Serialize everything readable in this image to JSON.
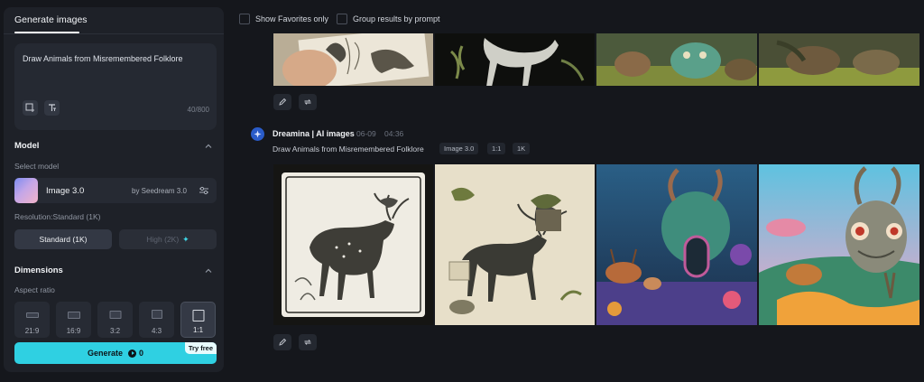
{
  "panel": {
    "tab_label": "Generate images",
    "prompt_text": "Draw Animals from Misremembered Folklore",
    "char_count": "40/800"
  },
  "model": {
    "section_title": "Model",
    "select_label": "Select model",
    "name": "Image 3.0",
    "provider": "by Seedream 3.0",
    "resolution_label": "Resolution:Standard (1K)",
    "res_standard": "Standard (1K)",
    "res_high": "High (2K)"
  },
  "dimensions": {
    "section_title": "Dimensions",
    "aspect_label": "Aspect ratio",
    "ratios": [
      "21:9",
      "16:9",
      "3:2",
      "4:3",
      "1:1"
    ],
    "selected": "1:1"
  },
  "generate": {
    "label": "Generate",
    "cost": "0",
    "badge": "Try free"
  },
  "filters": {
    "favorites_label": "Show Favorites only",
    "group_label": "Group results by prompt"
  },
  "generation": {
    "brand": "Dreamina | AI images",
    "date": "06-09",
    "time": "04:36",
    "prompt": "Draw Animals from Misremembered Folklore",
    "tags": [
      "Image 3.0",
      "1:1",
      "1K"
    ]
  },
  "colors": {
    "accent": "#2fd0e2",
    "background": "#15171c",
    "panel": "#1e2128"
  }
}
